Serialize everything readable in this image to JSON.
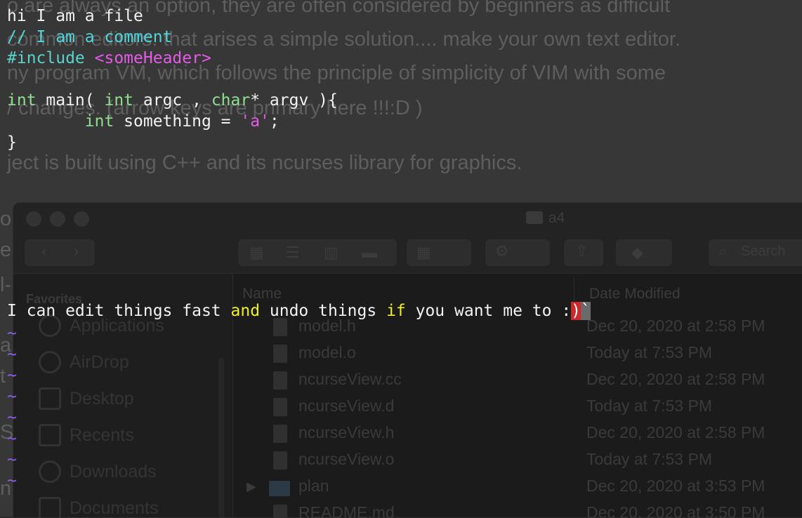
{
  "background_document": {
    "lines": [
      "o are always an option, they are often considered by beginners as difficult",
      "common editors. that arises a simple solution.... make your own text editor.",
      "ny program VM, which follows the principle of simplicity of VIM with some",
      "/ changes. (arrow keys are primary here !!!:D )",
      "ject is built using C++ and its ncurses library for graphics."
    ],
    "left_fragments": [
      "o",
      "e",
      "l-",
      "a",
      "t",
      "S",
      "n"
    ]
  },
  "finder": {
    "window_title": "a4",
    "search_placeholder": "Search",
    "sidebar": {
      "section_label": "Favorites",
      "items": [
        "Applications",
        "AirDrop",
        "Desktop",
        "Recents",
        "Downloads",
        "Documents"
      ]
    },
    "columns": {
      "name": "Name",
      "date": "Date Modified"
    },
    "files": [
      {
        "name": "model.h",
        "date": "Dec 20, 2020 at 2:58 PM",
        "kind": "c"
      },
      {
        "name": "model.o",
        "date": "Today at 7:53 PM",
        "kind": "doc"
      },
      {
        "name": "ncurseView.cc",
        "date": "Dec 20, 2020 at 2:58 PM",
        "kind": "c"
      },
      {
        "name": "ncurseView.d",
        "date": "Today at 7:53 PM",
        "kind": "doc"
      },
      {
        "name": "ncurseView.h",
        "date": "Dec 20, 2020 at 2:58 PM",
        "kind": "c"
      },
      {
        "name": "ncurseView.o",
        "date": "Today at 7:53 PM",
        "kind": "doc"
      },
      {
        "name": "plan",
        "date": "Dec 20, 2020 at 3:53 PM",
        "kind": "folder"
      },
      {
        "name": "README.md",
        "date": "Dec 20, 2020 at 3:50 PM",
        "kind": "doc"
      }
    ]
  },
  "editor": {
    "line1": "hi I am a file",
    "line2": "// I am a comment",
    "line3_directive": "#include",
    "line3_header": "<someHeader>",
    "line5": {
      "kw1": "int",
      "t1": " main( ",
      "kw2": "int",
      "t2": " argc , ",
      "kw3": "char",
      "t3": "* argv ){"
    },
    "line6": {
      "indent": "        ",
      "kw": "int",
      "t1": " something = ",
      "str": "'a'",
      "t2": ";"
    },
    "line7": "}",
    "status_line": {
      "t1": "I can edit things fast ",
      "kw1": "and",
      "t2": " undo things ",
      "kw2": "if",
      "t3": " you want me to :",
      "cursor_char": ")",
      "after_cursor": "`"
    },
    "tilde": "~",
    "colors": {
      "comment": "#4fd6dc",
      "directive": "#5ad3c9",
      "string": "#e45be8",
      "type": "#8ee08e",
      "keyword": "#eef02a",
      "tilde": "#8c5cf0",
      "cursor": "#cc2a2a"
    }
  }
}
